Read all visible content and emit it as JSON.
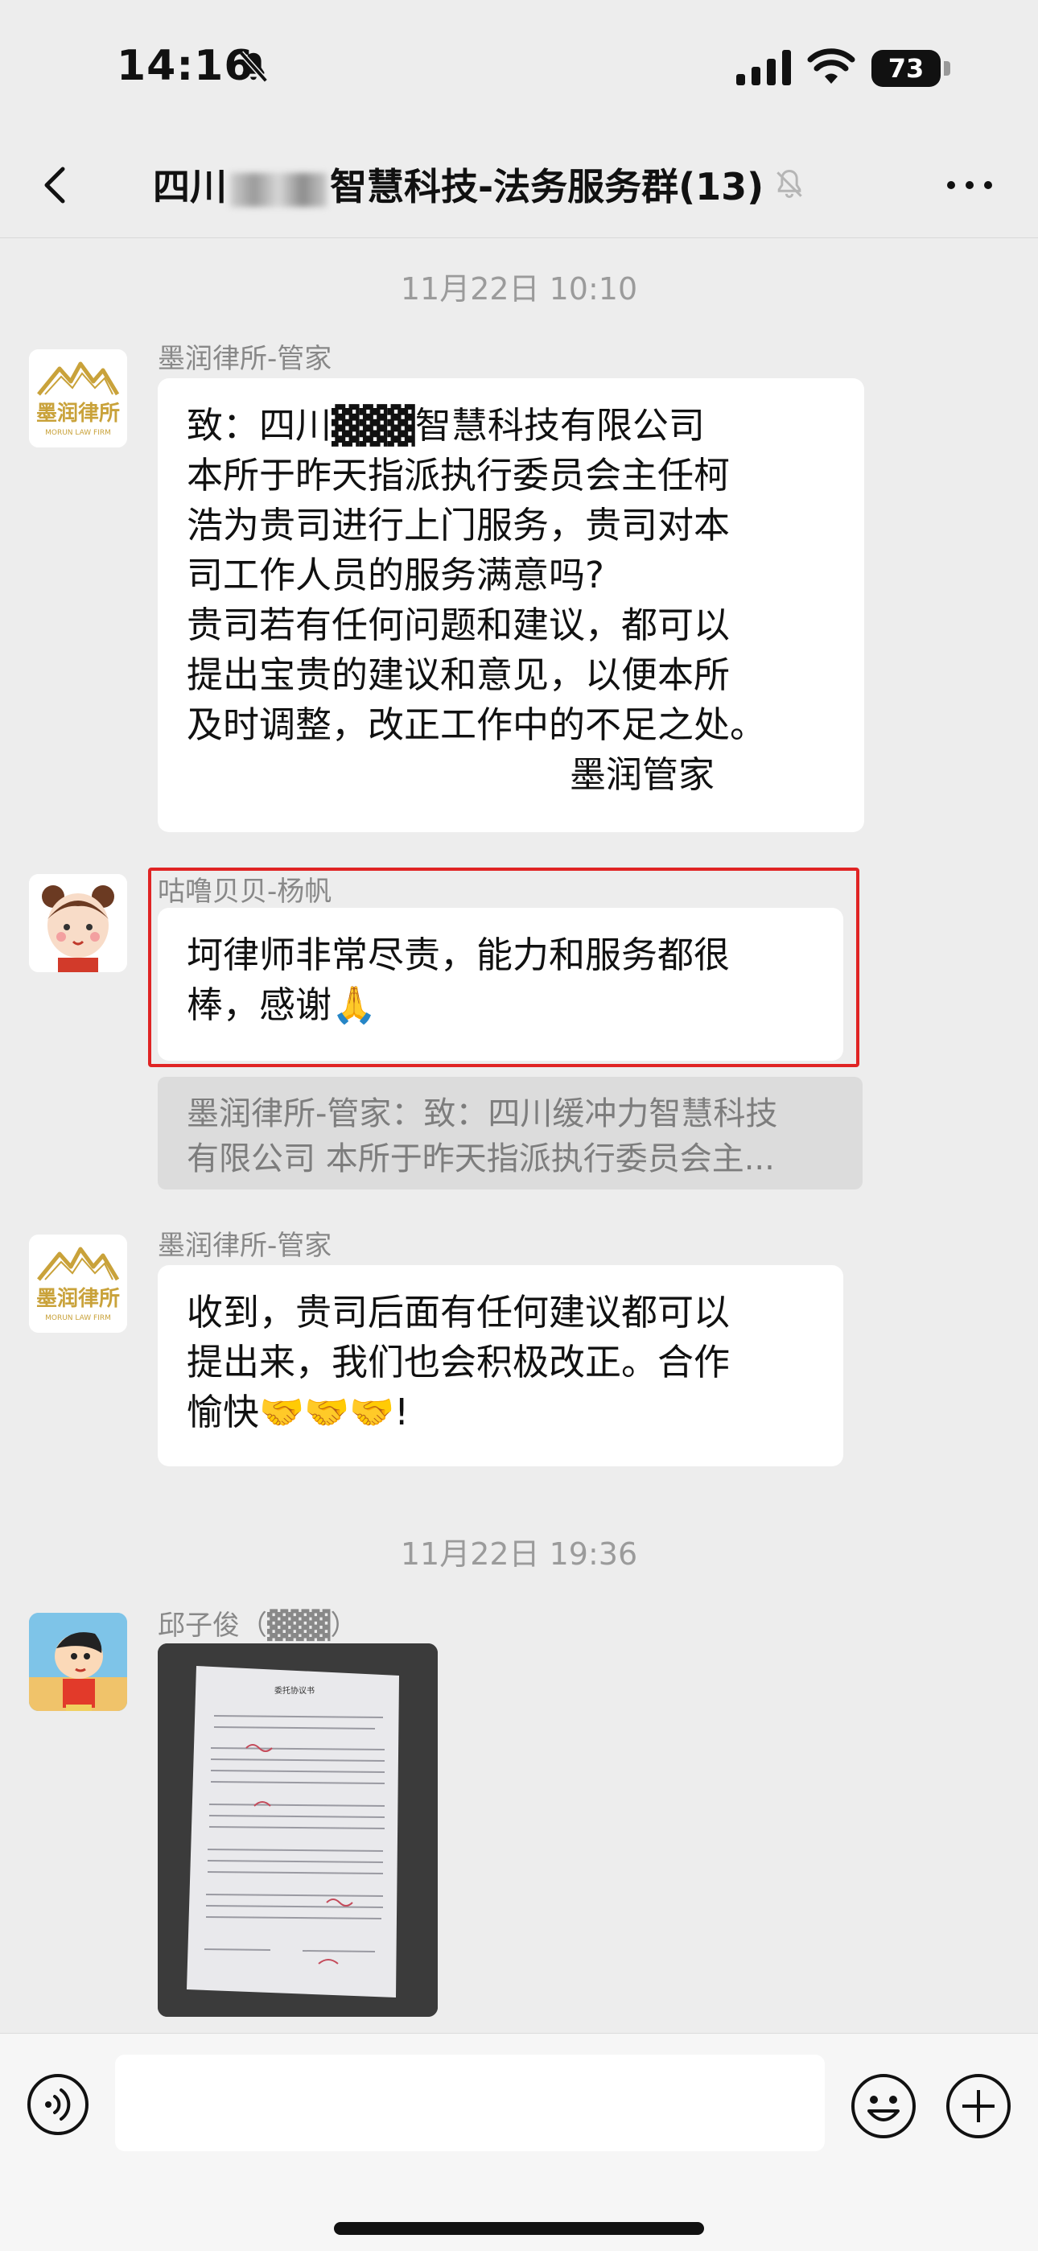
{
  "status_bar": {
    "time": "14:16",
    "battery": "73"
  },
  "header": {
    "title_prefix": "四川",
    "title_suffix": "智慧科技-法务服务群(13)"
  },
  "timestamps": {
    "first": "11月22日 10:10",
    "second": "11月22日 19:36"
  },
  "messages": {
    "m1": {
      "sender": "墨润律所-管家",
      "lines": [
        "致：四川▓▓▓智慧科技有限公司",
        "  本所于昨天指派执行委员会主任柯",
        "浩为贵司进行上门服务，贵司对本",
        "司工作人员的服务满意吗?",
        "贵司若有任何问题和建议，都可以",
        "提出宝贵的建议和意见，以便本所",
        "及时调整，改正工作中的不足之处。"
      ],
      "signature": "墨润管家"
    },
    "m2": {
      "sender": "咕噜贝贝-杨帆",
      "lines": [
        "坷律师非常尽责，能力和服务都很",
        "棒，感谢🙏"
      ],
      "quote": [
        "墨润律所-管家：致：四川缓冲力智慧科技",
        "有限公司   本所于昨天指派执行委员会主..."
      ]
    },
    "m3": {
      "sender": "墨润律所-管家",
      "lines": [
        "收到，贵司后面有任何建议都可以",
        "提出来，我们也会积极改正。合作",
        "愉快🤝🤝🤝!"
      ]
    },
    "m4": {
      "sender": "邱子俊（▓▓▓）",
      "image_alt": "委托协议书"
    }
  },
  "logo": {
    "name": "墨润律所",
    "sub": "MORUN LAW FIRM"
  },
  "input": {
    "placeholder": ""
  },
  "colors": {
    "highlight": "#e02424",
    "background": "#ededed"
  }
}
